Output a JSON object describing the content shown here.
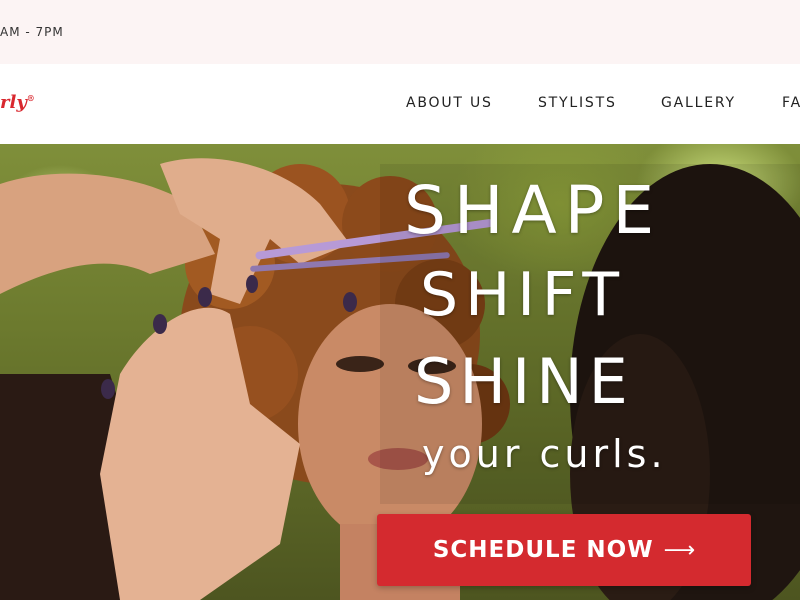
{
  "topbar": {
    "hours": "AM - 7PM"
  },
  "logo": {
    "text": "rly",
    "mark": "®"
  },
  "nav": {
    "items": [
      "ABOUT US",
      "STYLISTS",
      "GALLERY",
      "FA"
    ]
  },
  "hero": {
    "line1": "SHAPE",
    "line2": "SHIFT",
    "line3": "SHINE",
    "tagline": "your curls.",
    "cta_label": "SCHEDULE NOW",
    "cta_icon": "arrow-right-icon"
  },
  "colors": {
    "accent": "#d42a2f",
    "topbar_bg": "#fcf4f4",
    "nav_text": "#222222"
  }
}
